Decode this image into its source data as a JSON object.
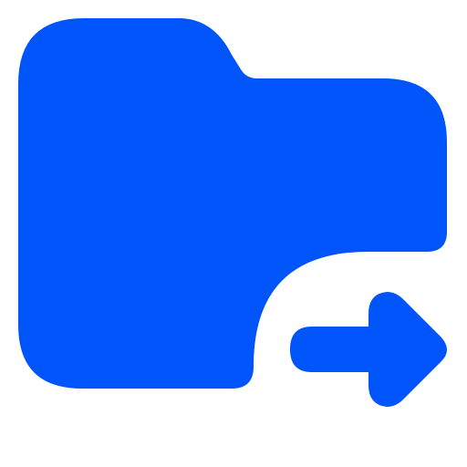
{
  "icon": {
    "name": "folder-move-icon",
    "parts": [
      "folder-icon",
      "arrow-right-icon"
    ],
    "color": "#0055FA",
    "background": "#FFFFFF"
  }
}
